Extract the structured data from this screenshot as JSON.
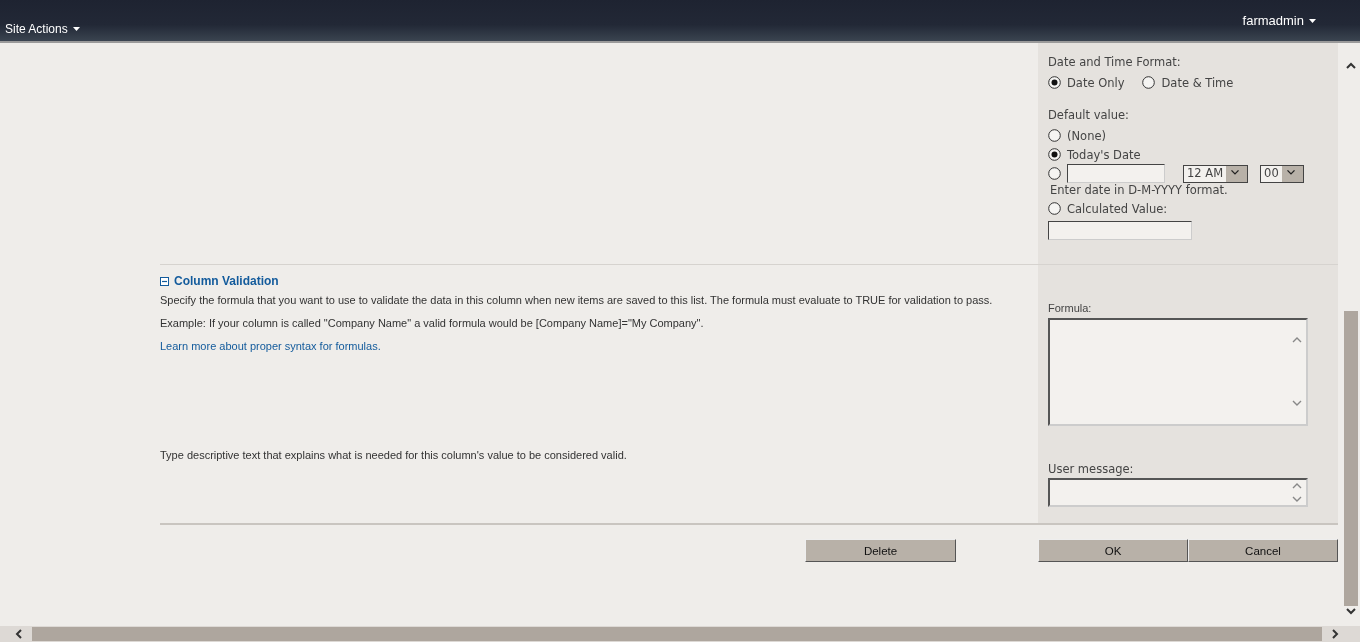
{
  "top_bar": {
    "site_actions": "Site Actions",
    "user": "farmadmin"
  },
  "date_settings": {
    "format_label": "Date and Time Format:",
    "format_options": [
      {
        "label": "Date Only",
        "selected": true
      },
      {
        "label": "Date & Time",
        "selected": false
      }
    ],
    "default_label": "Default value:",
    "default_options": [
      {
        "kind": "plain",
        "label": "(None)",
        "selected": false
      },
      {
        "kind": "plain",
        "label": "Today's Date",
        "selected": true
      },
      {
        "kind": "date",
        "selected": false,
        "hour": "12 AM",
        "minute": "00"
      },
      {
        "kind": "hint",
        "label": "Enter date in D-M-YYYY format."
      },
      {
        "kind": "calculated",
        "label": "Calculated Value:",
        "selected": false
      }
    ]
  },
  "validation": {
    "title": "Column Validation",
    "expanded": true,
    "description": "Specify the formula that you want to use to validate the data in this column when new items are saved to this list. The formula must evaluate to TRUE for validation to pass.",
    "example": "Example: If your column is called \"Company Name\" a valid formula would be [Company Name]=\"My Company\".",
    "link": "Learn more about proper syntax for formulas.",
    "message_help": "Type descriptive text that explains what is needed for this column's value to be considered valid.",
    "formula_label": "Formula:",
    "message_label": "User message:"
  },
  "buttons": [
    {
      "kind": "secondary",
      "label": "Delete"
    },
    {
      "kind": "primary",
      "label": "OK"
    },
    {
      "kind": "primary",
      "label": "Cancel"
    }
  ]
}
